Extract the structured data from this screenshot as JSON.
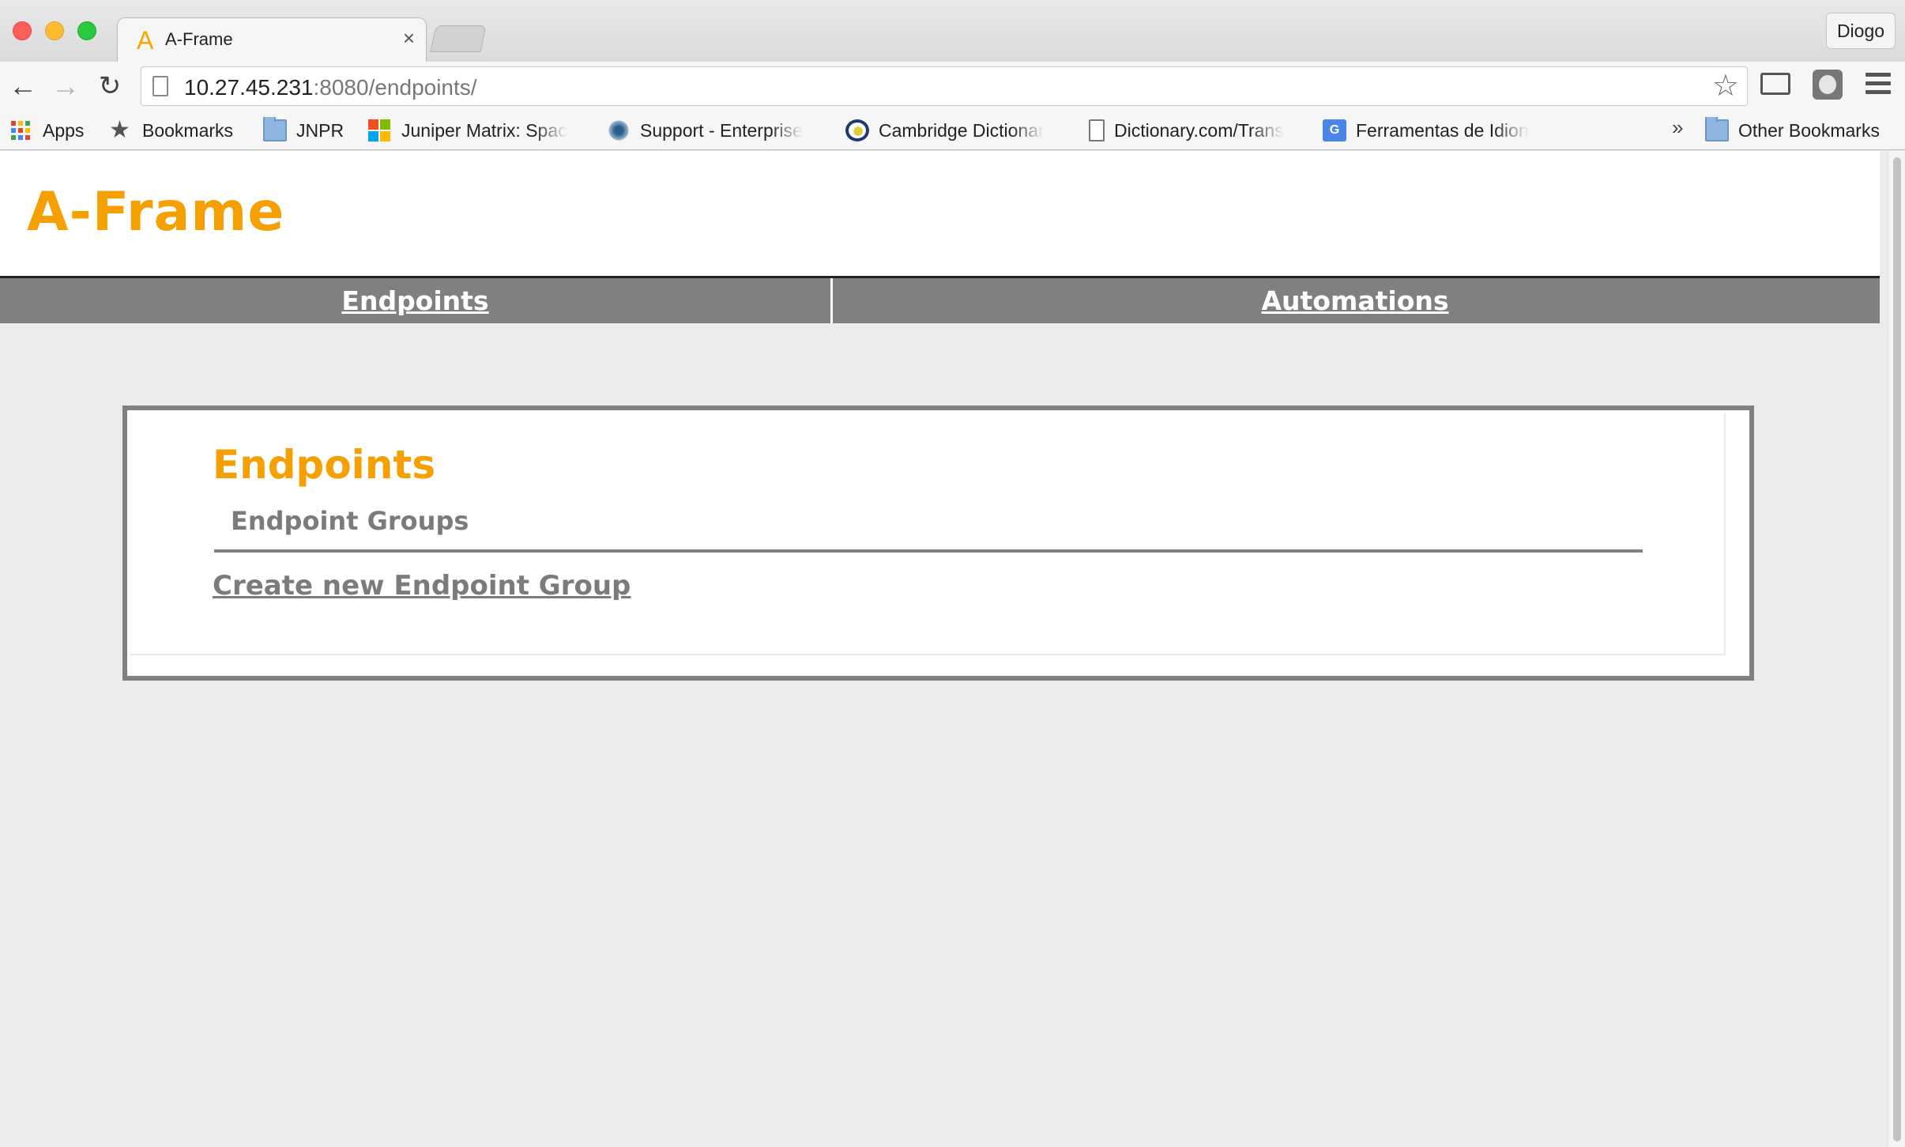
{
  "browser": {
    "tab": {
      "favicon": "A",
      "title": "A-Frame",
      "close": "×"
    },
    "profile": "Diogo",
    "address": {
      "host": "10.27.45.231",
      "rest": ":8080/endpoints/"
    },
    "bookmarks": [
      {
        "label": "Apps",
        "icon": "apps-grid-icon"
      },
      {
        "label": "Bookmarks",
        "icon": "star-icon"
      },
      {
        "label": "JNPR",
        "icon": "folder-icon"
      },
      {
        "label": "Juniper Matrix: Spac",
        "icon": "microsoft-icon"
      },
      {
        "label": "Support - Enterprise",
        "icon": "support-icon"
      },
      {
        "label": "Cambridge Dictionar",
        "icon": "cambridge-icon"
      },
      {
        "label": "Dictionary.com/Trans",
        "icon": "document-icon"
      },
      {
        "label": "Ferramentas de Idion",
        "icon": "google-translate-icon"
      }
    ],
    "more_bookmarks": "»",
    "other_bookmarks": "Other Bookmarks"
  },
  "page": {
    "site_title": "A-Frame",
    "nav": [
      {
        "label": "Endpoints"
      },
      {
        "label": "Automations"
      }
    ],
    "card": {
      "heading": "Endpoints",
      "subheading": "Endpoint Groups",
      "link": "Create new Endpoint Group"
    }
  },
  "colors": {
    "accent": "#f5a000",
    "nav_bar": "#808080",
    "muted_text": "#7b7b7b",
    "background": "#ececec"
  }
}
